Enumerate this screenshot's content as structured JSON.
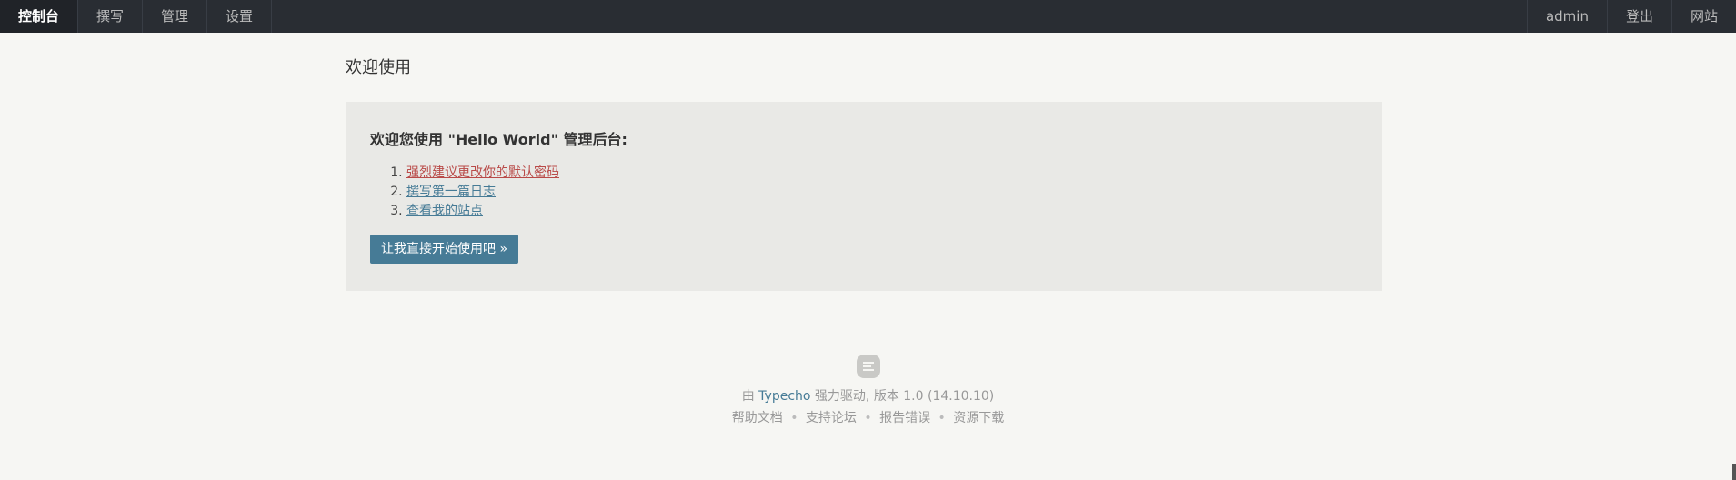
{
  "nav": {
    "left": [
      {
        "label": "控制台",
        "active": true
      },
      {
        "label": "撰写"
      },
      {
        "label": "管理"
      },
      {
        "label": "设置"
      }
    ],
    "right": [
      {
        "label": "admin"
      },
      {
        "label": "登出"
      },
      {
        "label": "网站"
      }
    ]
  },
  "page_title": "欢迎使用",
  "welcome": {
    "heading": "欢迎您使用 \"Hello World\" 管理后台:",
    "tasks": [
      {
        "label": "强烈建议更改你的默认密码",
        "style": "warning"
      },
      {
        "label": "撰写第一篇日志",
        "style": "link"
      },
      {
        "label": "查看我的站点",
        "style": "link"
      }
    ],
    "start_button": "让我直接开始使用吧 »"
  },
  "footer": {
    "logo_icon": "typecho-logo-icon",
    "prefix": "由",
    "brand": "Typecho",
    "suffix": "强力驱动, 版本 1.0 (14.10.10)",
    "links": [
      "帮助文档",
      "支持论坛",
      "报告错误",
      "资源下载"
    ],
    "separator": "•"
  },
  "colors": {
    "nav_bg": "#292D33",
    "page_bg": "#F6F6F3",
    "panel_bg": "#E9E9E6",
    "accent": "#467B96",
    "warning": "#B94A48"
  }
}
